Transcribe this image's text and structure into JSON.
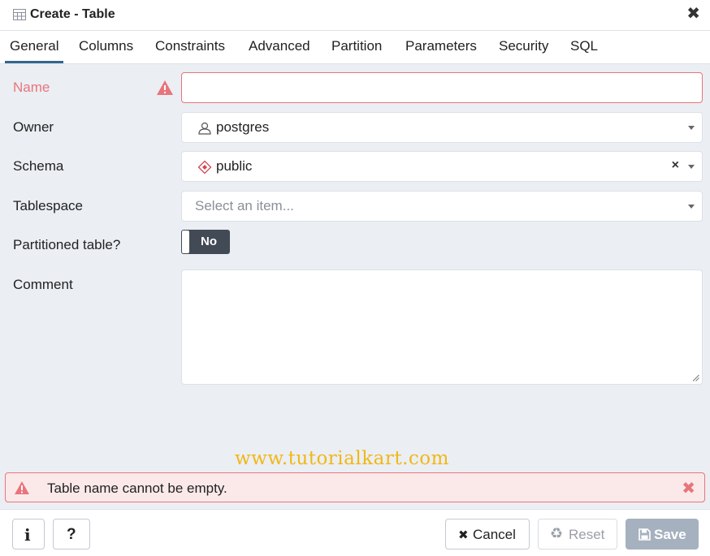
{
  "dialog": {
    "title": "Create - Table",
    "title_icon": "table-icon",
    "close_icon": "close-icon",
    "close_glyph": "✖"
  },
  "tabs": [
    {
      "label": "General",
      "active": true
    },
    {
      "label": "Columns"
    },
    {
      "label": "Constraints"
    },
    {
      "label": "Advanced"
    },
    {
      "label": "Partition"
    },
    {
      "label": "Parameters"
    },
    {
      "label": "Security"
    },
    {
      "label": "SQL"
    }
  ],
  "form": {
    "name": {
      "label": "Name",
      "value": "",
      "error": true,
      "warning_icon": "warning-icon"
    },
    "owner": {
      "label": "Owner",
      "value": "postgres",
      "icon": "user-icon"
    },
    "schema": {
      "label": "Schema",
      "value": "public",
      "icon": "schema-icon",
      "clear_glyph": "×"
    },
    "tablespace": {
      "label": "Tablespace",
      "placeholder": "Select an item..."
    },
    "partitioned": {
      "label": "Partitioned table?",
      "value": "No"
    },
    "comment": {
      "label": "Comment",
      "value": ""
    }
  },
  "watermark": "www.tutorialkart.com",
  "alert": {
    "message": "Table name cannot be empty.",
    "close_glyph": "✖"
  },
  "footer": {
    "info_glyph": "i",
    "help_glyph": "?",
    "cancel_label": "Cancel",
    "cancel_glyph": "✖",
    "reset_label": "Reset",
    "reset_glyph": "♻",
    "save_label": "Save",
    "save_glyph": "💾"
  },
  "colors": {
    "error": "#e8757b",
    "tab_active": "#326690",
    "toggle_bg": "#424a55",
    "save_bg": "#a6b1bf",
    "watermark": "#f0b816"
  }
}
